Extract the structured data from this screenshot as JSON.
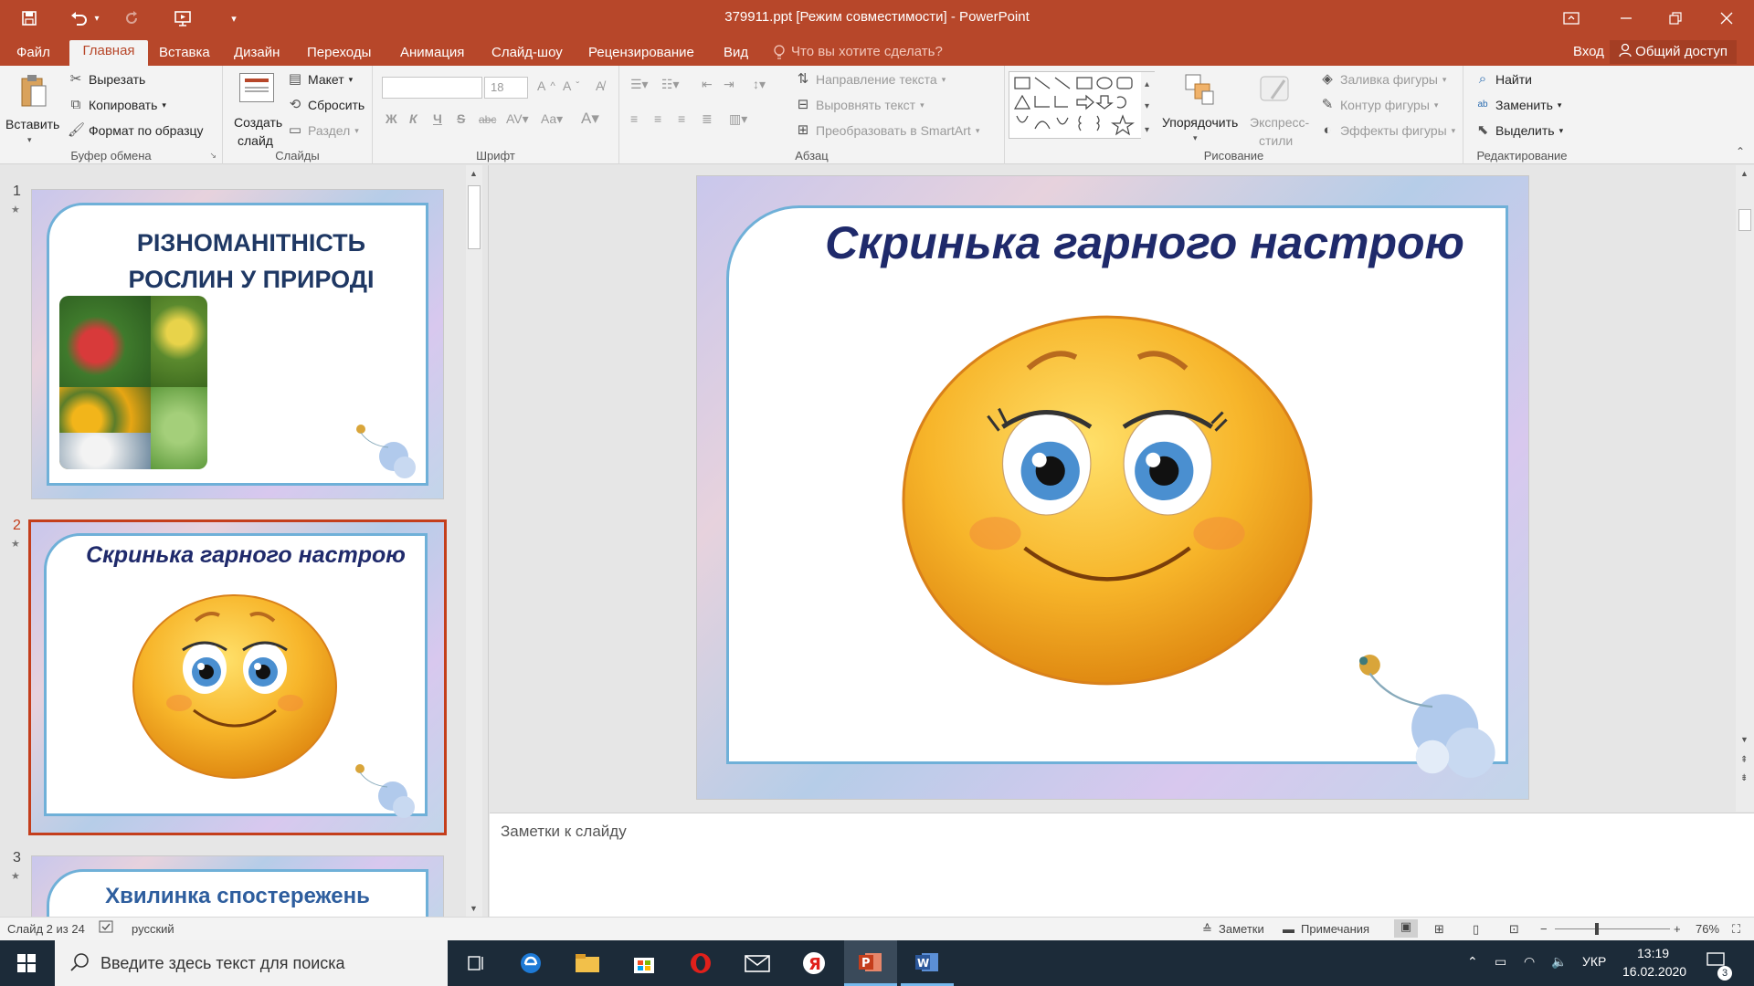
{
  "titlebar": {
    "title": "379911.ppt [Режим совместимости] - PowerPoint",
    "accent": "#b7472a"
  },
  "menu": {
    "tabs": [
      "Файл",
      "Главная",
      "Вставка",
      "Дизайн",
      "Переходы",
      "Анимация",
      "Слайд-шоу",
      "Рецензирование",
      "Вид"
    ],
    "active": "Главная",
    "tell_me": "Что вы хотите сделать?",
    "login": "Вход",
    "share": "Общий доступ"
  },
  "ribbon": {
    "clipboard": {
      "paste": "Вставить",
      "cut": "Вырезать",
      "copy": "Копировать",
      "format_painter": "Формат по образцу",
      "label": "Буфер обмена"
    },
    "slides": {
      "new_slide_line1": "Создать",
      "new_slide_line2": "слайд",
      "layout": "Макет",
      "reset": "Сбросить",
      "section": "Раздел",
      "label": "Слайды"
    },
    "font": {
      "size": "18",
      "label": "Шрифт",
      "bold": "Ж",
      "italic": "К",
      "underline": "Ч",
      "strike": "S",
      "shadow": "abc"
    },
    "paragraph": {
      "text_direction": "Направление текста",
      "align_text": "Выровнять текст",
      "smartart": "Преобразовать в SmartArt",
      "label": "Абзац"
    },
    "drawing": {
      "arrange": "Упорядочить",
      "quick_styles_line1": "Экспресс-",
      "quick_styles_line2": "стили",
      "fill": "Заливка фигуры",
      "outline": "Контур фигуры",
      "effects": "Эффекты фигуры",
      "label": "Рисование"
    },
    "editing": {
      "find": "Найти",
      "replace": "Заменить",
      "select": "Выделить",
      "label": "Редактирование"
    }
  },
  "slides_panel": {
    "slides": [
      {
        "num": "1",
        "title_line1": "РІЗНОМАНІТНІСТЬ",
        "title_line2": "РОСЛИН У ПРИРОДІ"
      },
      {
        "num": "2",
        "title": "Скринька гарного настрою"
      },
      {
        "num": "3",
        "title": "Хвилинка спостережень"
      }
    ]
  },
  "main_slide": {
    "title": "Скринька гарного настрою"
  },
  "notes": {
    "placeholder": "Заметки к слайду"
  },
  "statusbar": {
    "slide_count": "Слайд 2 из 24",
    "language": "русский",
    "notes": "Заметки",
    "comments": "Примечания",
    "zoom": "76%"
  },
  "taskbar": {
    "search_placeholder": "Введите здесь текст для поиска",
    "lang": "УКР",
    "time": "13:19",
    "date": "16.02.2020",
    "notification_count": "3"
  }
}
